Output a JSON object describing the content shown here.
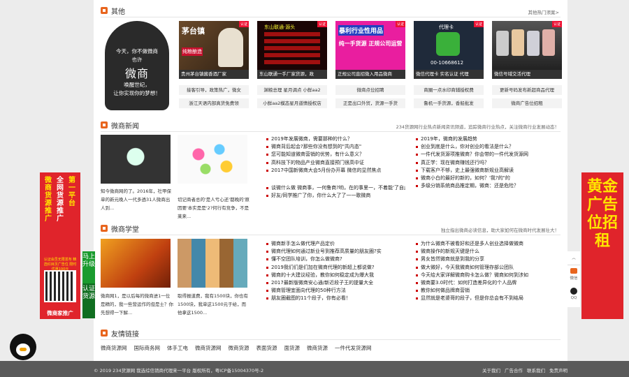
{
  "sections": {
    "other": {
      "title": "其他",
      "more": "其他热门须案>"
    },
    "news": {
      "title": "微商新闻",
      "more": "234货源网行业热点新闻资讯频道，追踪微商行业热点，关注微商行业发展动态！"
    },
    "school": {
      "title": "微商学堂",
      "more": "独立指出微商必读信息，助大家如何在微商时代发展壮大！"
    },
    "friends": {
      "title": "友情链接"
    }
  },
  "big_ad": {
    "line1": "今天，你不做微商",
    "line2": "也许",
    "big": "微商",
    "line3": "唤醒世纪，",
    "line4": "让你实现你的梦想！"
  },
  "thumbs": [
    {
      "caption": "贵州茅台镇酱香酒厂家",
      "tag": "认证",
      "label": "茅台镇",
      "sub": "纯粮酿造"
    },
    {
      "caption": "东山联通一手厂家货源，政",
      "tag": "认证",
      "label": "东山联通·源头",
      "sub": ""
    },
    {
      "caption": "正规公司直招微入用品微商",
      "tag": "认证",
      "label": "暴利行业性用品",
      "sub": "纯一手货源 正规公司运营"
    },
    {
      "caption": "微信代理卡 实名认证 代理",
      "tag": "认证",
      "label": "代理卡",
      "sub": "00-10668612"
    },
    {
      "caption": "微信号域交活代理",
      "tag": "认证",
      "label": "",
      "sub": ""
    }
  ],
  "thumb_links": [
    [
      "接客引导，政策热广，微女",
      "浙江天语内部真货免费领",
      "渊粮总理 星月调点 小鲜aa2"
    ],
    [
      "小鲜aa2模态星月道情授权店",
      "微商点位招聘",
      "正是出口外贸，货源一手货"
    ],
    [
      "商圈一点水印商辅授权费",
      "鲁机一手货源，香船批发",
      "更新号码发布新超商品代理"
    ],
    [
      "微商广告位招租"
    ]
  ],
  "news_imgs": [
    {
      "caption": "知今微商网的了。2016年，社甲保单的新元晚人一代多透31人微商出人到..."
    },
    {
      "caption": "切记商者总的'是人亏心还'都晚的'原因要'本实是是'2?何行有竞争，不是莱来..."
    }
  ],
  "news_list_left": [
    "2019年发展微商，需要那种的什么？",
    "微商背后起会?那些你没有想到的\"共内态\"",
    "您可能知道微商营销的优势，有什么意义？",
    "高科技下的物品产业微商直接预门很高中证",
    "2017中国新微商大会5月份办开幕 微信的显然焦点",
    "谈微什么做 微商事，一何鲁商?哟，在的事里一，不着能'了自此后来",
    "好友/同学推广了你，你什么大了了一一歌微商"
  ],
  "news_list_right": [
    "2019年，微商的发展趋势",
    "创业到底是什么，你对创业的看法是什么？",
    "一件代发货源项推微商？你会带的一件代发货源网",
    "真正学：现在微商赚钱还行吗？",
    "下载客户不够，史上最强微商新规业高解读",
    "微商小白的最好的新的，如何？'我?的\"的",
    "多级分销系统商品推定期，微商：还是危险？"
  ],
  "school_imgs": [
    {
      "caption": "微商网1，是以后每的微商进1一位是精的，我一些营运作的但是士？你先想得一下解..."
    },
    {
      "caption": "取得报道费，我有1500块，你也有1500块，我单这1500元于给，而他拿这1500..."
    }
  ],
  "school_list_left": [
    "微商新手怎么做代理产品定价",
    "微商代理如何通过新业号到推荐高质量的朋友圈?实",
    "懂不空团队培训，你怎么做微商?",
    "2019我们们是们加在微商代理的新超上都说做?",
    "微商的十大建议经验，教你如何稳定成为爆大我",
    "2017最新版微商安心通/新近段子王的提量大全",
    "微商管理宜面向代理的50种行方法",
    "朋友圈截图的11个段子，你有必看！"
  ],
  "school_list_right": [
    "为什么微商不被看好和还是多人创业选择做微商",
    "微商操作的新规天键是什么",
    "男女皆然微商就是到我的分享",
    "做大微好，今天我微商如何管理存部公团队",
    "今天给大家详解微商购卡怎么做？微商如何到涉如",
    "微商要3.0时代：如何打造差异化的个人品牌",
    "教你如何做品牌商营销",
    "显然就是老婆哥的段子，但是你总会有不到结局"
  ],
  "friend_links": [
    "微商货源网",
    "国际商务网",
    "体手工电",
    "微商货源网",
    "微商货源",
    "表面货源",
    "面货源",
    "微商货源",
    "一件代发货源网"
  ],
  "footer": {
    "copy": "© 2019 234货源网 我选综信销商代理来一平台 版权所有，粤ICP备15004370号-2",
    "links": [
      "关于我们",
      "广告合作",
      "联系我们",
      "免责声明"
    ]
  },
  "side_left": {
    "cols": [
      "微商货源推广",
      "全网货源推广",
      "第一平台"
    ],
    "sub": "认证会员无限发布 精选红目页广告位 限时优惠100元",
    "foot": "微商家推广"
  },
  "side_left_bar": {
    "a": "马上升级",
    "b": "认证货源"
  },
  "side_right": {
    "text": "黄金广告位招租"
  },
  "right_tools": {
    "a": "微信",
    "b": "QQ"
  }
}
